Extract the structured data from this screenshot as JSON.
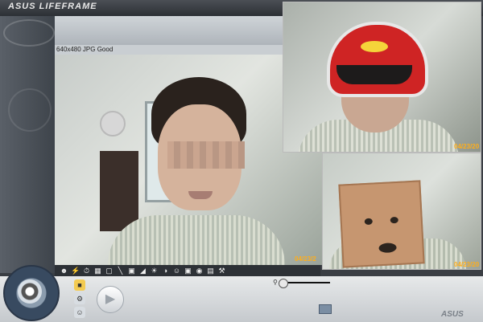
{
  "app": {
    "brand": "ASUS",
    "product": "LIFEFRAME"
  },
  "main_view": {
    "info": "640x480 JPG Good",
    "timestamp": "04/23/2"
  },
  "previews": [
    {
      "timestamp": "04/23/20"
    },
    {
      "timestamp": "04/23/20"
    }
  ],
  "effects_toolbar": {
    "icons": [
      "people-icon",
      "lightning-icon",
      "timer-icon",
      "burst-icon",
      "frame-icon",
      "ruler-icon",
      "page-icon",
      "brightness-icon",
      "sun-icon",
      "contrast-icon",
      "face-icon",
      "focus-icon",
      "color-icon",
      "picture-icon",
      "wrench-icon"
    ]
  },
  "bottom": {
    "modes": [
      "folder-icon",
      "settings-icon",
      "face-mode-icon"
    ],
    "footer_logo": "ASUS"
  },
  "colors": {
    "accent": "#f3cb52",
    "timestamp": "#ffae1a",
    "helmet": "#cf2424"
  }
}
